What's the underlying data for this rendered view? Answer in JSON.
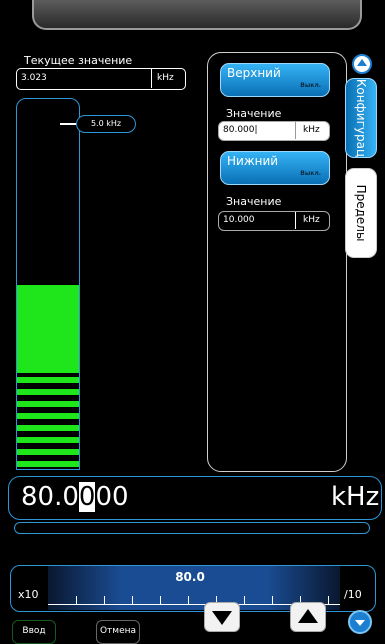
{
  "current": {
    "label": "Текущее значение",
    "value": "3.023",
    "unit": "kHz"
  },
  "meter": {
    "marker_label": "5.0 kHz",
    "level_fraction": 0.5
  },
  "limits": {
    "upper": {
      "label": "Верхний",
      "state": "Выкл.",
      "value_label": "Значение",
      "value": "80.000|",
      "unit": "kHz"
    },
    "lower": {
      "label": "Нижний",
      "state": "Выкл.",
      "value_label": "Значение",
      "value": "10.000",
      "unit": "kHz"
    }
  },
  "tabs": {
    "config": "Конфигурац",
    "limits": "Пределы"
  },
  "entry": {
    "value_before": "80.0",
    "value_selected": "0",
    "value_after": "00",
    "unit": "kHz"
  },
  "slider": {
    "value": "80.0",
    "left_label": "x10",
    "right_label": "/10"
  },
  "buttons": {
    "enter": "Ввод",
    "cancel": "Отмена"
  }
}
